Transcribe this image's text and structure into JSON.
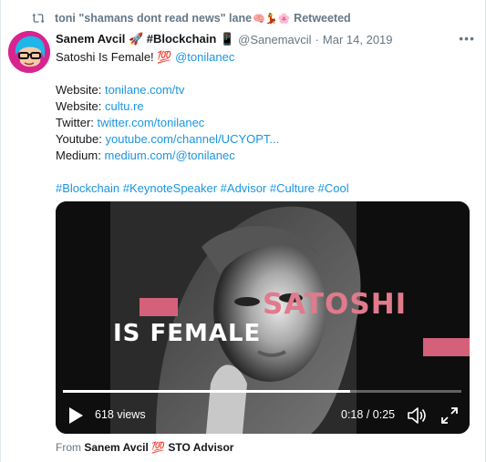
{
  "retweet": {
    "icon": "retweet-icon",
    "retweeter_name": "toni \"shamans dont read news\" lane",
    "emojis": "🧠💃🌸",
    "suffix": "Retweeted"
  },
  "tweet": {
    "author_name": "Sanem Avcil 🚀 #Blockchain 📱",
    "handle": "@Sanemavcil",
    "separator": "·",
    "date": "Mar 14, 2019",
    "more_icon": "more-horizontal-icon",
    "more_label": "•••",
    "text_intro": "Satoshi Is Female! 💯",
    "mention": "@tonilanec",
    "links": [
      {
        "label": "Website:",
        "url": "tonilane.com/tv"
      },
      {
        "label": "Website:",
        "url": "cultu.re"
      },
      {
        "label": "Twitter:",
        "url": "twitter.com/tonilanec"
      },
      {
        "label": "Youtube:",
        "url": "youtube.com/channel/UCYOPT..."
      },
      {
        "label": "Medium:",
        "url": "medium.com/@tonilanec"
      }
    ],
    "hashtags": "#Blockchain #KeynoteSpeaker #Advisor #Culture #Cool"
  },
  "video": {
    "overlay_title_1": "SATOSHI",
    "overlay_title_2": "IS FEMALE",
    "views": "618 views",
    "current_time": "0:18",
    "time_separator": "/",
    "duration": "0:25",
    "progress": 0.72,
    "accent_color": "#e07a8c"
  },
  "footer": {
    "from_prefix": "From",
    "source_name": "Sanem Avcil 💯 STO Advisor"
  },
  "colors": {
    "link": "#1b95e0",
    "muted": "#657786",
    "text": "#14171a"
  }
}
